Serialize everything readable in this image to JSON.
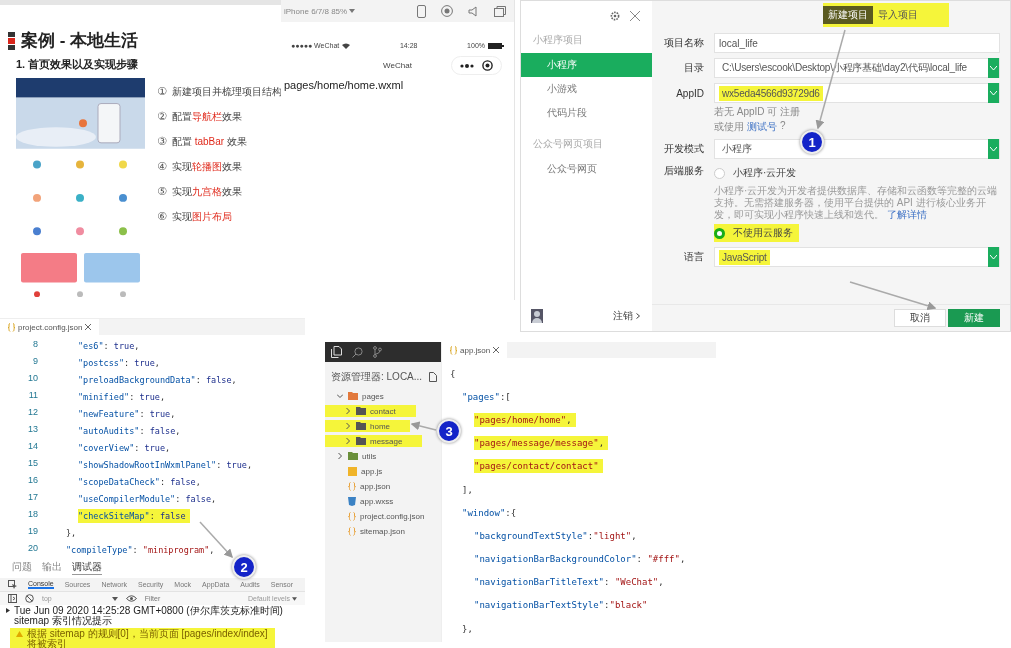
{
  "slide": {
    "title": "案例 - 本地生活",
    "subtitle": "1. 首页效果以及实现步骤",
    "steps": [
      {
        "num": "①",
        "parts": [
          {
            "text": "新建项目并梳理项目结构",
            "accent": false
          }
        ]
      },
      {
        "num": "②",
        "parts": [
          {
            "text": "配置",
            "accent": false
          },
          {
            "text": "导航栏",
            "accent": true
          },
          {
            "text": "效果",
            "accent": false
          }
        ]
      },
      {
        "num": "③",
        "parts": [
          {
            "text": "配置 ",
            "accent": false
          },
          {
            "text": "tabBar",
            "accent": true
          },
          {
            "text": " 效果",
            "accent": false
          }
        ]
      },
      {
        "num": "④",
        "parts": [
          {
            "text": "实现",
            "accent": false
          },
          {
            "text": "轮播图",
            "accent": true
          },
          {
            "text": "效果",
            "accent": false
          }
        ]
      },
      {
        "num": "⑤",
        "parts": [
          {
            "text": "实现",
            "accent": false
          },
          {
            "text": "九宫格",
            "accent": true
          },
          {
            "text": "效果",
            "accent": false
          }
        ]
      },
      {
        "num": "⑥",
        "parts": [
          {
            "text": "实现",
            "accent": false
          },
          {
            "text": "图片布局",
            "accent": true
          }
        ]
      }
    ]
  },
  "simulator": {
    "device": "iPhone 6/7/8 85%",
    "carrier": "●●●●● WeChat",
    "time": "14:28",
    "battery": "100%",
    "nav_title": "WeChat",
    "page_path": "pages/home/home.wxml"
  },
  "dialog": {
    "sidebar": {
      "sections": [
        {
          "title": "小程序项目",
          "items": [
            {
              "label": "小程序",
              "selected": true
            },
            {
              "label": "小游戏",
              "selected": false
            },
            {
              "label": "代码片段",
              "selected": false
            }
          ]
        },
        {
          "title": "公众号网页项目",
          "items": [
            {
              "label": "公众号网页",
              "selected": false
            }
          ]
        }
      ],
      "logout": "注销"
    },
    "tabs": [
      {
        "label": "新建项目",
        "selected": true
      },
      {
        "label": "导入项目",
        "selected": false
      }
    ],
    "tabs_highlighted": true,
    "name": {
      "label": "项目名称",
      "value": "local_life"
    },
    "directory": {
      "label": "目录",
      "value": "C:\\Users\\escook\\Desktop\\小程序基础\\day2\\代码\\local_life"
    },
    "appid": {
      "label": "AppID",
      "value": "wx5eda4566d93729d6",
      "highlighted": true,
      "hint": "若无 AppID 可 注册",
      "alt_prefix": "或使用",
      "alt_link": "测试号",
      "help": "?"
    },
    "mode": {
      "label": "开发模式",
      "value": "小程序"
    },
    "backend": {
      "label": "后端服务",
      "options": [
        {
          "label": "小程序·云开发",
          "selected": false,
          "highlighted": false,
          "description": "小程序·云开发为开发者提供数据库、存储和云函数等完整的云端支持。无需搭建服务器，使用平台提供的 API 进行核心业务开发，即可实现小程序快速上线和迭代。",
          "link": "了解详情"
        },
        {
          "label": "不使用云服务",
          "selected": true,
          "highlighted": true
        }
      ]
    },
    "language": {
      "label": "语言",
      "value": "JavaScript",
      "highlighted": true
    },
    "buttons": [
      {
        "label": "取消",
        "kind": "secondary"
      },
      {
        "label": "新建",
        "kind": "primary"
      }
    ],
    "callout": "1"
  },
  "editor": {
    "tab": "project.config.json",
    "lines": [
      {
        "no": "8",
        "kind": "item",
        "highlighted": false,
        "tokens": [
          {
            "kind": "key",
            "t": "\"es6\""
          },
          {
            "kind": "p",
            "t": ": "
          },
          {
            "kind": "lit",
            "t": "true"
          },
          {
            "kind": "p",
            "t": ","
          }
        ]
      },
      {
        "no": "9",
        "kind": "item",
        "highlighted": false,
        "tokens": [
          {
            "kind": "key",
            "t": "\"postcss\""
          },
          {
            "kind": "p",
            "t": ": "
          },
          {
            "kind": "lit",
            "t": "true"
          },
          {
            "kind": "p",
            "t": ","
          }
        ]
      },
      {
        "no": "10",
        "kind": "item",
        "highlighted": false,
        "tokens": [
          {
            "kind": "key",
            "t": "\"preloadBackgroundData\""
          },
          {
            "kind": "p",
            "t": ": "
          },
          {
            "kind": "lit",
            "t": "false"
          },
          {
            "kind": "p",
            "t": ","
          }
        ]
      },
      {
        "no": "11",
        "kind": "item",
        "highlighted": false,
        "tokens": [
          {
            "kind": "key",
            "t": "\"minified\""
          },
          {
            "kind": "p",
            "t": ": "
          },
          {
            "kind": "lit",
            "t": "true"
          },
          {
            "kind": "p",
            "t": ","
          }
        ]
      },
      {
        "no": "12",
        "kind": "item",
        "highlighted": false,
        "tokens": [
          {
            "kind": "key",
            "t": "\"newFeature\""
          },
          {
            "kind": "p",
            "t": ": "
          },
          {
            "kind": "lit",
            "t": "true"
          },
          {
            "kind": "p",
            "t": ","
          }
        ]
      },
      {
        "no": "13",
        "kind": "item",
        "highlighted": false,
        "tokens": [
          {
            "kind": "key",
            "t": "\"autoAudits\""
          },
          {
            "kind": "p",
            "t": ": "
          },
          {
            "kind": "lit",
            "t": "false"
          },
          {
            "kind": "p",
            "t": ","
          }
        ]
      },
      {
        "no": "14",
        "kind": "item",
        "highlighted": false,
        "tokens": [
          {
            "kind": "key",
            "t": "\"coverView\""
          },
          {
            "kind": "p",
            "t": ": "
          },
          {
            "kind": "lit",
            "t": "true"
          },
          {
            "kind": "p",
            "t": ","
          }
        ]
      },
      {
        "no": "15",
        "kind": "item",
        "highlighted": false,
        "tokens": [
          {
            "kind": "key",
            "t": "\"showShadowRootInWxmlPanel\""
          },
          {
            "kind": "p",
            "t": ": "
          },
          {
            "kind": "lit",
            "t": "true"
          },
          {
            "kind": "p",
            "t": ","
          }
        ]
      },
      {
        "no": "16",
        "kind": "item",
        "highlighted": false,
        "tokens": [
          {
            "kind": "key",
            "t": "\"scopeDataCheck\""
          },
          {
            "kind": "p",
            "t": ": "
          },
          {
            "kind": "lit",
            "t": "false"
          },
          {
            "kind": "p",
            "t": ","
          }
        ]
      },
      {
        "no": "17",
        "kind": "item",
        "highlighted": false,
        "tokens": [
          {
            "kind": "key",
            "t": "\"useCompilerModule\""
          },
          {
            "kind": "p",
            "t": ": "
          },
          {
            "kind": "lit",
            "t": "false"
          },
          {
            "kind": "p",
            "t": ","
          }
        ]
      },
      {
        "no": "18",
        "kind": "item",
        "highlighted": true,
        "tokens": [
          {
            "kind": "key",
            "t": "\"checkSiteMap\""
          },
          {
            "kind": "p",
            "t": ": "
          },
          {
            "kind": "lit",
            "t": "false"
          }
        ]
      },
      {
        "no": "19",
        "kind": "member",
        "highlighted": false,
        "tokens": [
          {
            "kind": "p",
            "t": "},"
          }
        ]
      },
      {
        "no": "20",
        "kind": "member",
        "highlighted": false,
        "tokens": [
          {
            "kind": "key",
            "t": "\"compileType\""
          },
          {
            "kind": "p",
            "t": ": "
          },
          {
            "kind": "str",
            "t": "\"miniprogram\""
          },
          {
            "kind": "p",
            "t": ","
          }
        ]
      }
    ],
    "panel_tabs": [
      {
        "label": "问题",
        "selected": false
      },
      {
        "label": "输出",
        "selected": false
      },
      {
        "label": "调试器",
        "selected": true
      }
    ],
    "devtools_tabs": [
      {
        "label": "Console",
        "selected": true
      },
      {
        "label": "Sources",
        "selected": false
      },
      {
        "label": "Network",
        "selected": false
      },
      {
        "label": "Security",
        "selected": false
      },
      {
        "label": "Mock",
        "selected": false
      },
      {
        "label": "AppData",
        "selected": false
      },
      {
        "label": "Audits",
        "selected": false
      },
      {
        "label": "Sensor",
        "selected": false
      }
    ],
    "context": "top",
    "filter_placeholder": "Filter",
    "levels": "Default levels",
    "messages": [
      {
        "kind": "info",
        "text": "Tue Jun 09 2020 14:25:28 GMT+0800 (伊尔库茨克标准时间) sitemap 索引情况提示",
        "highlighted": false
      },
      {
        "kind": "warning",
        "text": "根据 sitemap 的规则[0]，当前页面 [pages/index/index] 将被索引",
        "highlighted": true
      }
    ],
    "callout": "2"
  },
  "explorer": {
    "title": "资源管理器: LOCA...",
    "tree": [
      {
        "label": "pages",
        "kind": "folder",
        "expanded": true,
        "highlighted": false,
        "children": [
          {
            "label": "contact",
            "kind": "folder",
            "expanded": false,
            "highlighted": true
          },
          {
            "label": "home",
            "kind": "folder",
            "expanded": false,
            "highlighted": true
          },
          {
            "label": "message",
            "kind": "folder",
            "expanded": false,
            "highlighted": true
          }
        ]
      },
      {
        "label": "utils",
        "kind": "folder",
        "expanded": false,
        "highlighted": false
      },
      {
        "label": "app.js",
        "kind": "js",
        "highlighted": false
      },
      {
        "label": "app.json",
        "kind": "json",
        "highlighted": false
      },
      {
        "label": "app.wxss",
        "kind": "css",
        "highlighted": false
      },
      {
        "label": "project.config.json",
        "kind": "json",
        "highlighted": false
      },
      {
        "label": "sitemap.json",
        "kind": "json",
        "highlighted": false
      }
    ]
  },
  "app_json": {
    "tab": "app.json",
    "lines": [
      {
        "kind": "root",
        "highlighted": false,
        "tokens": [
          {
            "kind": "p",
            "t": "{"
          }
        ]
      },
      {
        "kind": "member",
        "highlighted": false,
        "tokens": [
          {
            "kind": "key",
            "t": "\"pages\""
          },
          {
            "kind": "p",
            "t": ":["
          }
        ]
      },
      {
        "kind": "item",
        "highlighted": true,
        "tokens": [
          {
            "kind": "str",
            "t": "\"pages/home/home\""
          },
          {
            "kind": "p",
            "t": ","
          }
        ]
      },
      {
        "kind": "item",
        "highlighted": true,
        "tokens": [
          {
            "kind": "str",
            "t": "\"pages/message/message\""
          },
          {
            "kind": "p",
            "t": ","
          }
        ]
      },
      {
        "kind": "item",
        "highlighted": true,
        "tokens": [
          {
            "kind": "str",
            "t": "\"pages/contact/contact\""
          }
        ]
      },
      {
        "kind": "member",
        "highlighted": false,
        "tokens": [
          {
            "kind": "p",
            "t": "],"
          }
        ]
      },
      {
        "kind": "member",
        "highlighted": false,
        "tokens": [
          {
            "kind": "key",
            "t": "\"window\""
          },
          {
            "kind": "p",
            "t": ":{"
          }
        ]
      },
      {
        "kind": "item",
        "highlighted": false,
        "tokens": [
          {
            "kind": "key",
            "t": "\"backgroundTextStyle\""
          },
          {
            "kind": "p",
            "t": ":"
          },
          {
            "kind": "str",
            "t": "\"light\""
          },
          {
            "kind": "p",
            "t": ","
          }
        ]
      },
      {
        "kind": "item",
        "highlighted": false,
        "tokens": [
          {
            "kind": "key",
            "t": "\"navigationBarBackgroundColor\""
          },
          {
            "kind": "p",
            "t": ": "
          },
          {
            "kind": "str",
            "t": "\"#fff\""
          },
          {
            "kind": "p",
            "t": ","
          }
        ]
      },
      {
        "kind": "item",
        "highlighted": false,
        "tokens": [
          {
            "kind": "key",
            "t": "\"navigationBarTitleText\""
          },
          {
            "kind": "p",
            "t": ": "
          },
          {
            "kind": "str",
            "t": "\"WeChat\""
          },
          {
            "kind": "p",
            "t": ","
          }
        ]
      },
      {
        "kind": "item",
        "highlighted": false,
        "tokens": [
          {
            "kind": "key",
            "t": "\"navigationBarTextStyle\""
          },
          {
            "kind": "p",
            "t": ":"
          },
          {
            "kind": "str",
            "t": "\"black\""
          }
        ]
      },
      {
        "kind": "member",
        "highlighted": false,
        "tokens": [
          {
            "kind": "p",
            "t": "},"
          }
        ]
      }
    ],
    "callout": "3"
  }
}
